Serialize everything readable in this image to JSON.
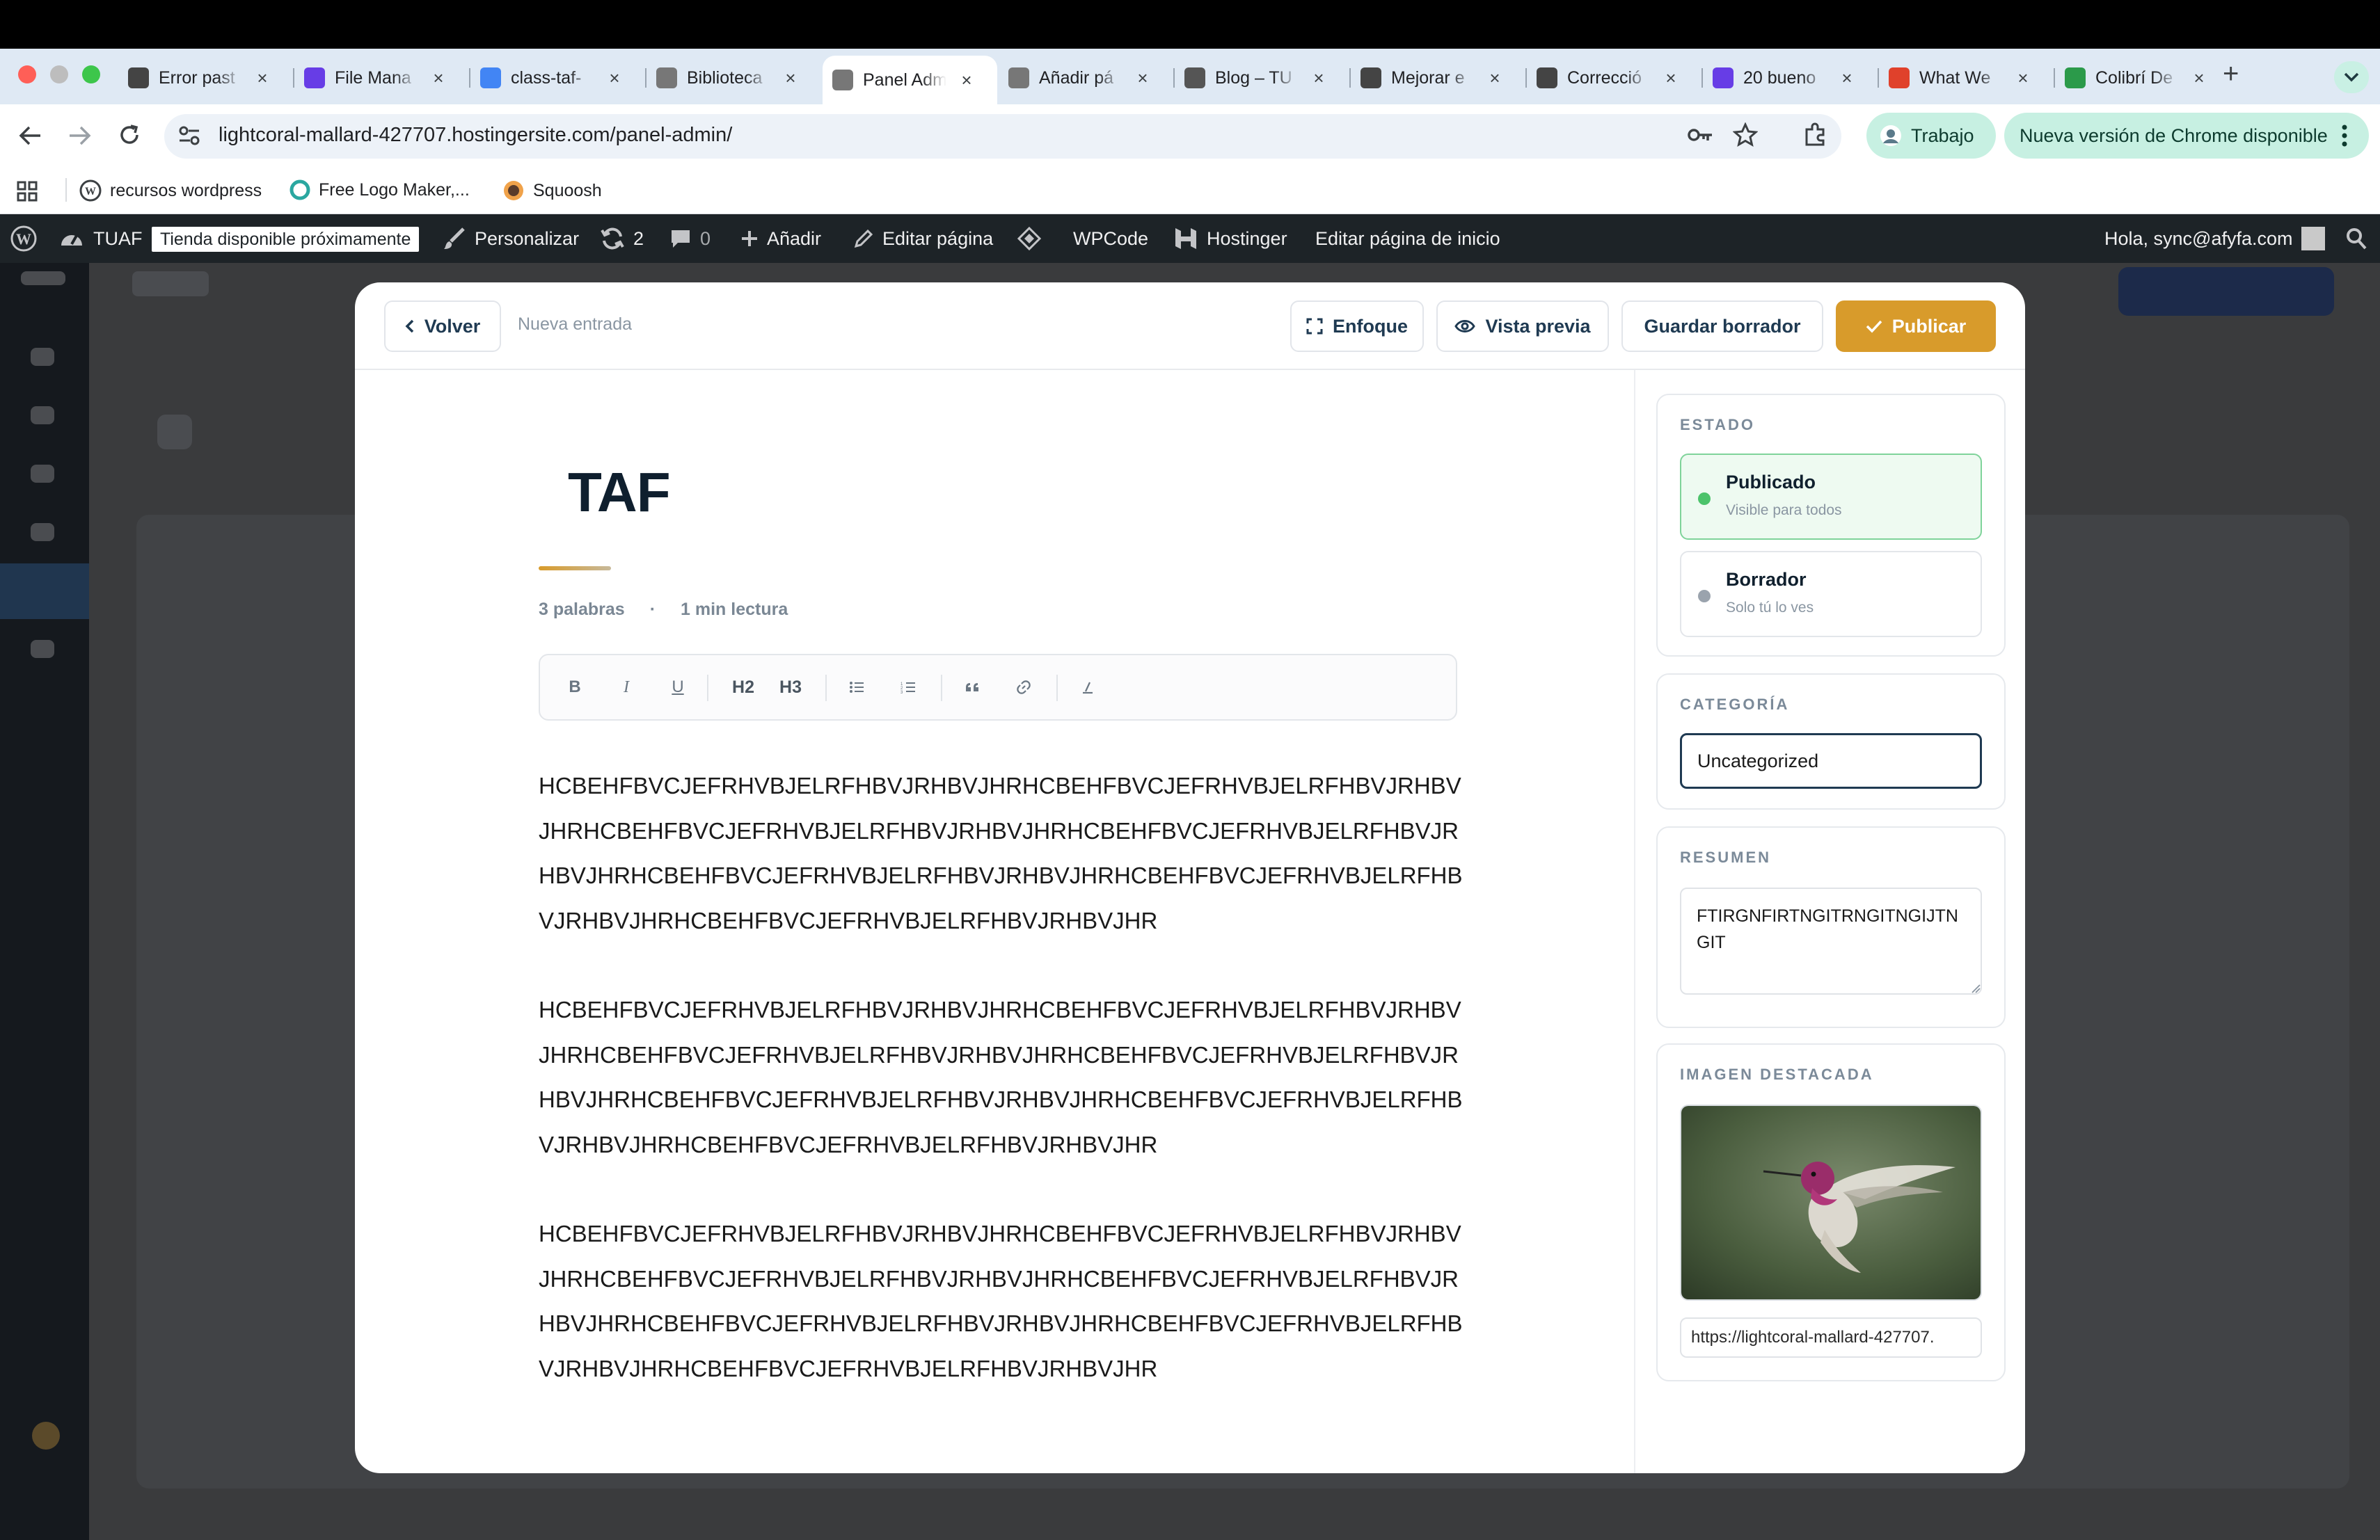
{
  "browser": {
    "tabs": [
      {
        "title": "Error past",
        "favicon": "openai-icon",
        "color": "#444"
      },
      {
        "title": "File Mana",
        "favicon": "hostinger-icon",
        "color": "#673de6"
      },
      {
        "title": "class-taf-",
        "favicon": "gemini-icon",
        "color": "#4285f4"
      },
      {
        "title": "Biblioteca",
        "favicon": "tuaf-icon",
        "color": "#777"
      },
      {
        "title": "Panel Adm",
        "favicon": "tuaf-icon",
        "color": "#777"
      },
      {
        "title": "Añadir pá",
        "favicon": "tuaf-icon",
        "color": "#777"
      },
      {
        "title": "Blog – TU",
        "favicon": "wordpress-icon",
        "color": "#555"
      },
      {
        "title": "Mejorar e",
        "favicon": "openai-icon",
        "color": "#444"
      },
      {
        "title": "Correcció",
        "favicon": "openai-icon",
        "color": "#444"
      },
      {
        "title": "20 bueno",
        "favicon": "hostinger-icon",
        "color": "#673de6"
      },
      {
        "title": "What We",
        "favicon": "t-icon",
        "color": "#e0412b"
      },
      {
        "title": "Colibrí De",
        "favicon": "px-icon",
        "color": "#2b9a4a"
      }
    ],
    "url": "lightcoral-mallard-427707.hostingersite.com/panel-admin/",
    "profile_label": "Trabajo",
    "update_label": "Nueva versión de Chrome disponible",
    "bookmarks": [
      "recursos wordpress",
      "Free Logo Maker,...",
      "Squoosh"
    ]
  },
  "adminbar": {
    "site_name": "TUAF",
    "store_badge": "Tienda disponible próximamente",
    "customize": "Personalizar",
    "updates_count": "2",
    "comments_count": "0",
    "add_new": "Añadir",
    "edit_page": "Editar página",
    "wpcode": "WPCode",
    "hostinger": "Hostinger",
    "edit_home": "Editar página de inicio",
    "greeting": "Hola, sync@afyfa.com"
  },
  "editor": {
    "back_label": "Volver",
    "breadcrumb": "Nueva entrada",
    "focus_label": "Enfoque",
    "preview_label": "Vista previa",
    "draft_label": "Guardar borrador",
    "publish_label": "Publicar",
    "post_title": "TAF",
    "word_count": "3 palabras",
    "meta_sep": "·",
    "read_time": "1 min lectura",
    "toolbar": {
      "bold": "B",
      "italic": "I",
      "underline": "U",
      "h2": "H2",
      "h3": "H3"
    },
    "paragraphs": [
      "HCBEHFBVCJEFRHVBJELRFHBVJRHBVJHRHCBEHFBVCJEFRHVBJELRFHBVJRHBVJHRHCBEHFBVCJEFRHVBJELRFHBVJRHBVJHRHCBEHFBVCJEFRHVBJELRFHBVJRHBVJHRHCBEHFBVCJEFRHVBJELRFHBVJRHBVJHRHCBEHFBVCJEFRHVBJELRFHBVJRHBVJHRHCBEHFBVCJEFRHVBJELRFHBVJRHBVJHR",
      "HCBEHFBVCJEFRHVBJELRFHBVJRHBVJHRHCBEHFBVCJEFRHVBJELRFHBVJRHBVJHRHCBEHFBVCJEFRHVBJELRFHBVJRHBVJHRHCBEHFBVCJEFRHVBJELRFHBVJRHBVJHRHCBEHFBVCJEFRHVBJELRFHBVJRHBVJHRHCBEHFBVCJEFRHVBJELRFHBVJRHBVJHRHCBEHFBVCJEFRHVBJELRFHBVJRHBVJHR",
      "HCBEHFBVCJEFRHVBJELRFHBVJRHBVJHRHCBEHFBVCJEFRHVBJELRFHBVJRHBVJHRHCBEHFBVCJEFRHVBJELRFHBVJRHBVJHRHCBEHFBVCJEFRHVBJELRFHBVJRHBVJHRHCBEHFBVCJEFRHVBJELRFHBVJRHBVJHRHCBEHFBVCJEFRHVBJELRFHBVJRHBVJHRHCBEHFBVCJEFRHVBJELRFHBVJRHBVJHR"
    ]
  },
  "sidebar": {
    "status_label": "ESTADO",
    "published_title": "Publicado",
    "published_sub": "Visible para todos",
    "draft_title": "Borrador",
    "draft_sub": "Solo tú lo ves",
    "category_label": "CATEGORÍA",
    "category_value": "Uncategorized",
    "excerpt_label": "RESUMEN",
    "excerpt_value": "FTIRGNFIRTNGITRNGITNGIJTNGIT",
    "image_label": "IMAGEN DESTACADA",
    "image_url": "https://lightcoral-mallard-427707."
  },
  "colors": {
    "accent": "#d89b2b",
    "published_green": "#4cc36b",
    "draft_grey": "#9aa3ad"
  }
}
